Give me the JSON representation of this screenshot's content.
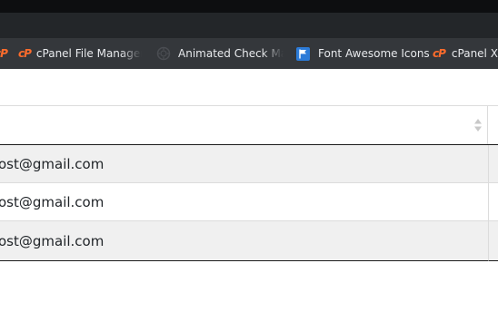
{
  "bookmarks": [
    {
      "icon": "cpanel-icon",
      "label": "cPanel File Manager v"
    },
    {
      "icon": "animated-check-icon",
      "label": "Animated Check Mar"
    },
    {
      "icon": "font-awesome-flag-icon",
      "label": "Font Awesome Icons"
    },
    {
      "icon": "cpanel-icon",
      "label": "cPanel X"
    }
  ],
  "table": {
    "rows": [
      {
        "email": "ost@gmail.com"
      },
      {
        "email": "ost@gmail.com"
      },
      {
        "email": "ost@gmail.com"
      }
    ]
  },
  "colors": {
    "cpanel_orange": "#ff6c2c",
    "font_awesome_blue": "#2c7bd8",
    "bookmarks_bar": "#34373b",
    "striped_row": "#f0f0f0"
  }
}
